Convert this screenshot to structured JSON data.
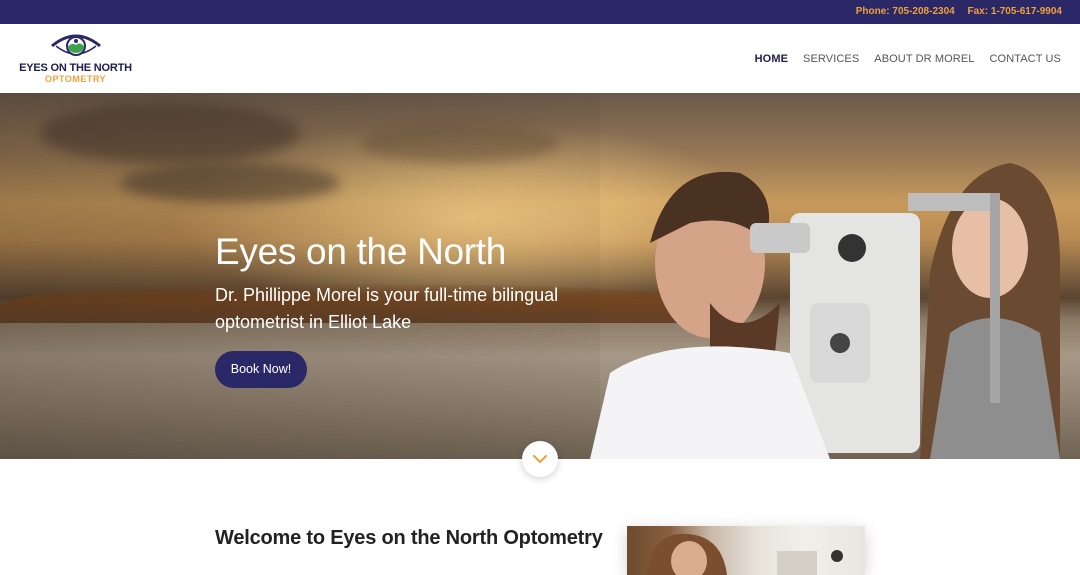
{
  "topbar": {
    "phone": "Phone: 705-208-2304",
    "fax": "Fax: 1-705-617-9904"
  },
  "logo": {
    "title": "EYES ON THE NORTH",
    "subtitle": "OPTOMETRY"
  },
  "nav": {
    "items": [
      {
        "label": "HOME",
        "active": true
      },
      {
        "label": "SERVICES",
        "active": false
      },
      {
        "label": "ABOUT DR MOREL",
        "active": false
      },
      {
        "label": "CONTACT US",
        "active": false
      }
    ]
  },
  "hero": {
    "title": "Eyes on the North",
    "subtitle": "Dr. Phillippe Morel is your full-time bilingual optometrist in Elliot Lake",
    "cta": "Book Now!"
  },
  "welcome": {
    "heading": "Welcome to Eyes on the North Optometry"
  },
  "colors": {
    "brand_navy": "#2b2868",
    "brand_orange": "#f0a03a",
    "logo_green": "#3fa34d"
  },
  "icons": {
    "scroll": "chevron-down-icon",
    "logo": "eye-logo-icon"
  }
}
